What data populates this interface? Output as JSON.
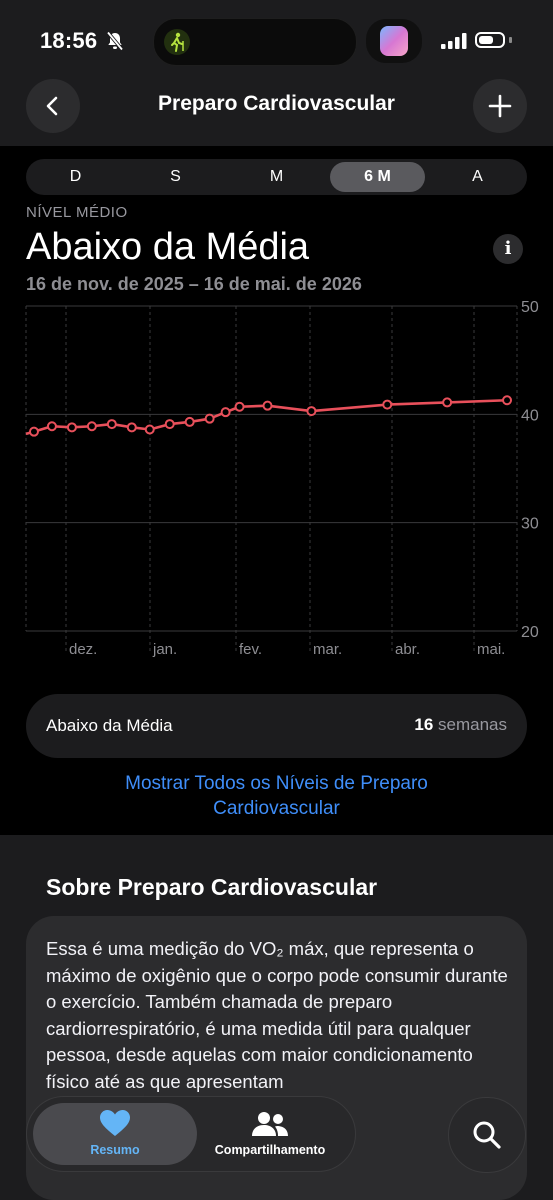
{
  "status": {
    "time": "18:56"
  },
  "nav": {
    "title": "Preparo Cardiovascular"
  },
  "ranges": [
    "D",
    "S",
    "M",
    "6 M",
    "A"
  ],
  "selected_range": "6 M",
  "level": {
    "caption": "NÍVEL MÉDIO",
    "value": "Abaixo da Média",
    "info": "i",
    "date_range": "16 de nov. de 2025 – 16 de mai. de 2026"
  },
  "chart_data": {
    "type": "line",
    "ylim": [
      20,
      50
    ],
    "y_ticks": [
      "50",
      "40",
      "30",
      "20"
    ],
    "x_labels": [
      "dez.",
      "jan.",
      "fev.",
      "mar.",
      "abr.",
      "mai."
    ],
    "line_color": "#e8505b",
    "series": [
      {
        "x": [
          0.4,
          1.3,
          2.3,
          3.3,
          4.3,
          5.3,
          6.2,
          7.2,
          8.2,
          9.2,
          10.0,
          10.7,
          12.1,
          14.3,
          18.1,
          21.1,
          24.1
        ],
        "values": [
          38.4,
          38.9,
          38.8,
          38.9,
          39.1,
          38.8,
          38.6,
          39.1,
          39.3,
          39.6,
          40.2,
          40.7,
          40.8,
          40.3,
          40.9,
          41.1,
          41.3
        ]
      }
    ]
  },
  "summary": {
    "label": "Abaixo da Média",
    "count": "16",
    "unit": "semanas"
  },
  "show_all": "Mostrar Todos os Níveis de Preparo Cardiovascular",
  "about": {
    "title": "Sobre Preparo Cardiovascular",
    "text": "Essa é uma medição do VO₂ máx, que representa o máximo de oxigênio que o corpo pode consumir durante o exercício. Também chamada de preparo cardiorrespiratório, é uma medida útil para qualquer pessoa, desde aquelas com maior condicionamento físico até as que apresentam"
  },
  "tabs": [
    {
      "label": "Resumo",
      "icon": "heart-icon"
    },
    {
      "label": "Compartilhamento",
      "icon": "people-icon"
    }
  ],
  "colors": {
    "accent": "#3f8ef9",
    "heart": "#64b5f6"
  }
}
